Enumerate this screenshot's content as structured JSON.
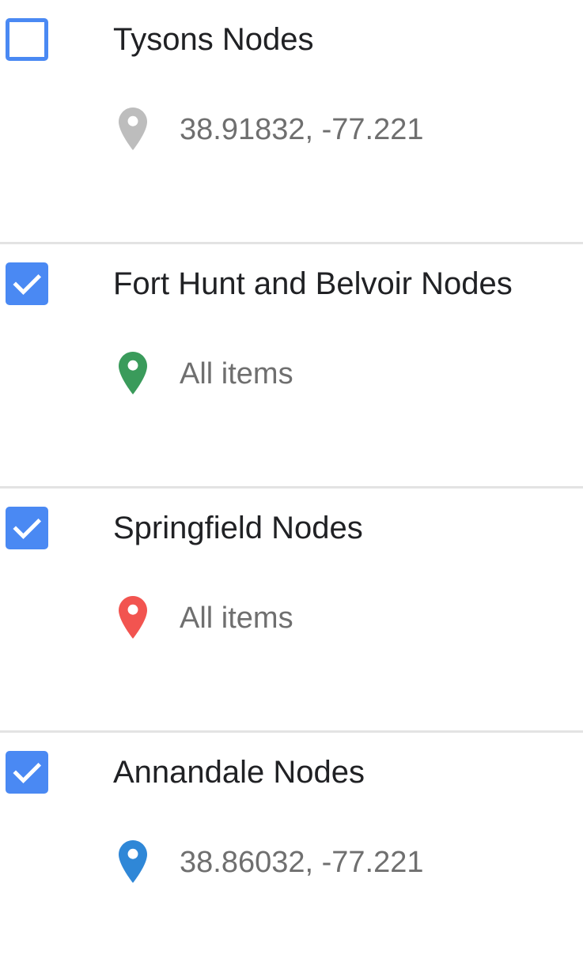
{
  "layers": [
    {
      "title": "Tysons Nodes",
      "checked": false,
      "style_label": "38.91832, -77.221",
      "pin_color": "#bdbdbd",
      "pin_icon": "map-marker-icon"
    },
    {
      "title": "Fort Hunt and Belvoir Nodes",
      "checked": true,
      "style_label": "All items",
      "pin_color": "#3a9b5b",
      "pin_icon": "map-marker-icon"
    },
    {
      "title": "Springfield Nodes",
      "checked": true,
      "style_label": "All items",
      "pin_color": "#f25450",
      "pin_icon": "map-marker-icon"
    },
    {
      "title": "Annandale Nodes",
      "checked": true,
      "style_label": "38.86032, -77.221",
      "pin_color": "#2f87d7",
      "pin_icon": "map-marker-icon"
    }
  ],
  "colors": {
    "checkbox_accent": "#4a89f3",
    "divider": "#e3e3e3",
    "title_text": "#202124",
    "label_text": "#6f6f6f"
  }
}
